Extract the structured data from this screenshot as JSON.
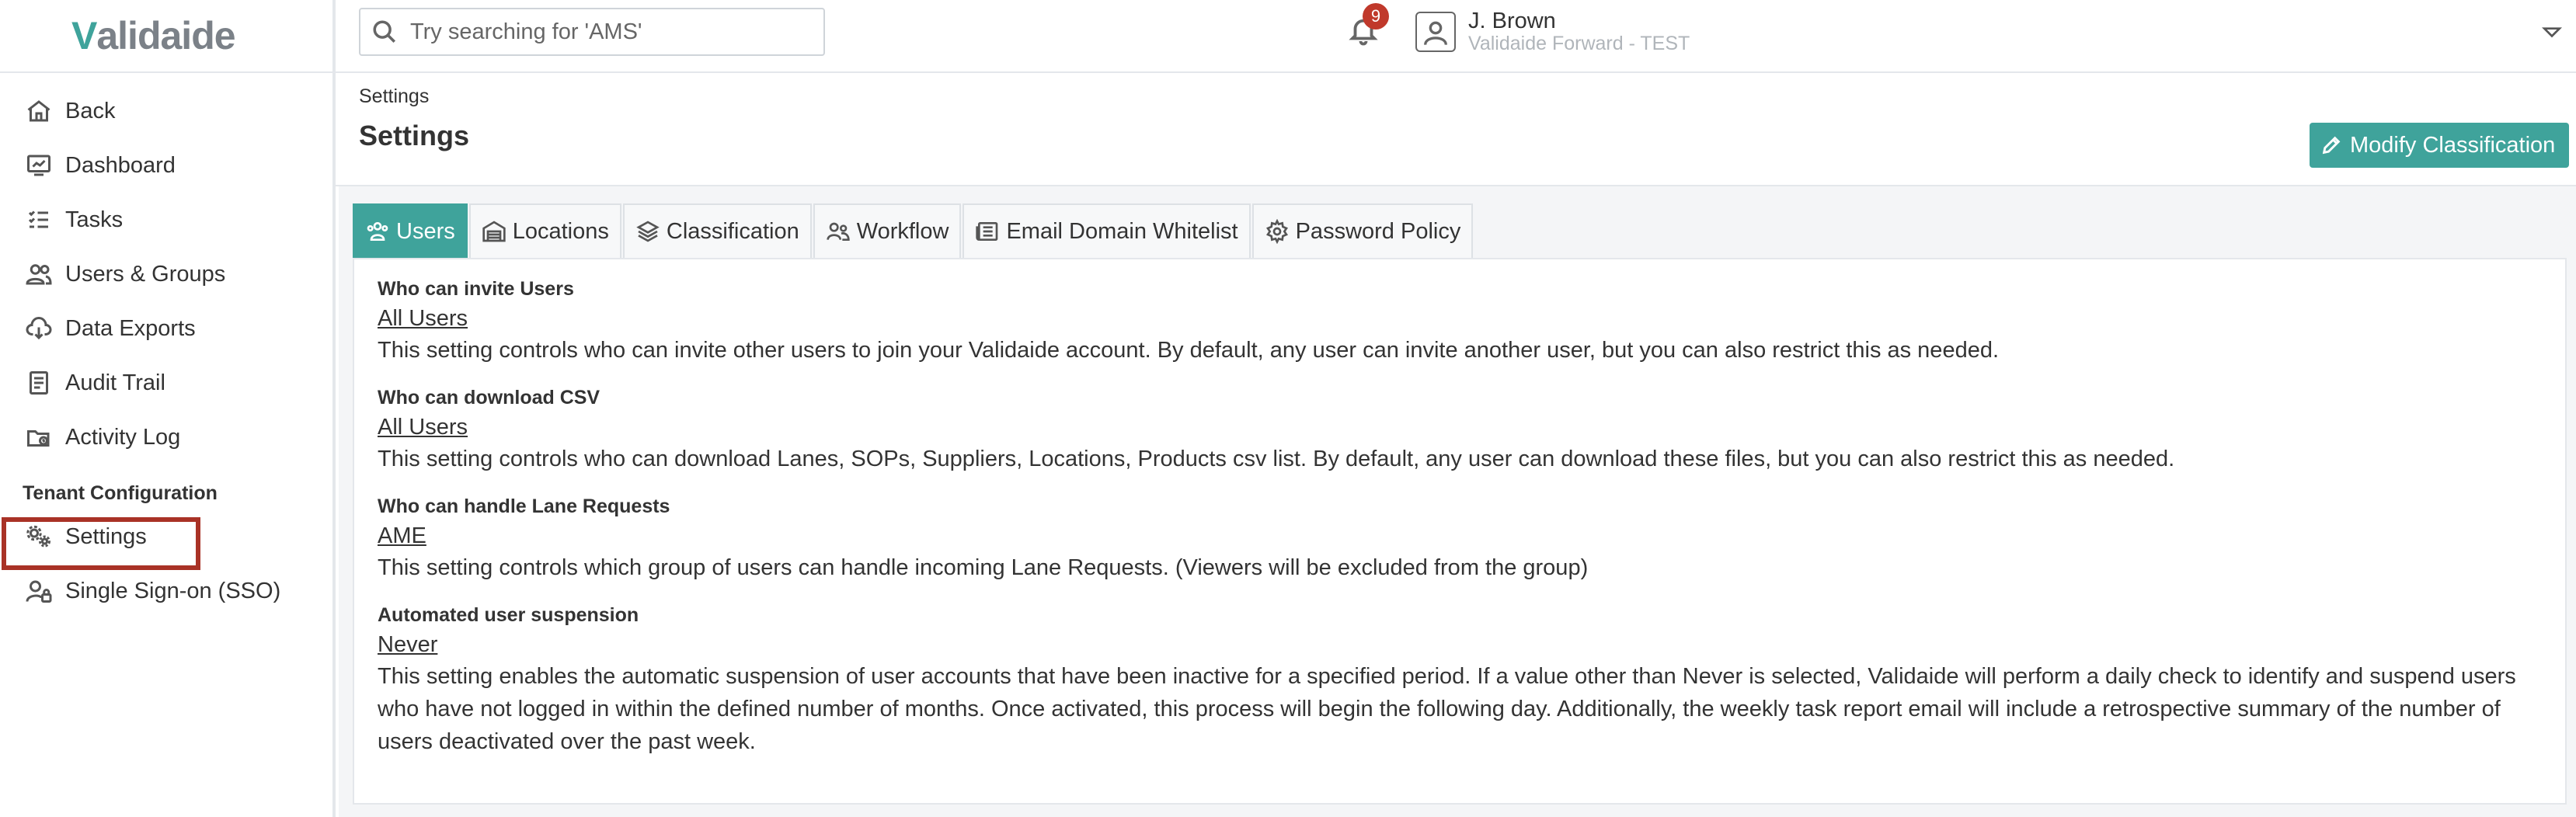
{
  "logo": "Validaide",
  "search": {
    "placeholder": "Try searching for 'AMS'"
  },
  "notifications": {
    "count": "9"
  },
  "user": {
    "name": "J. Brown",
    "org": "Validaide Forward - TEST"
  },
  "sidebar": {
    "items": [
      {
        "label": "Back",
        "icon": "home-icon"
      },
      {
        "label": "Dashboard",
        "icon": "dashboard-icon"
      },
      {
        "label": "Tasks",
        "icon": "tasks-icon"
      },
      {
        "label": "Users & Groups",
        "icon": "users-icon"
      },
      {
        "label": "Data Exports",
        "icon": "download-icon"
      },
      {
        "label": "Audit Trail",
        "icon": "audit-icon"
      },
      {
        "label": "Activity Log",
        "icon": "activity-icon"
      }
    ],
    "section_title": "Tenant Configuration",
    "config_items": [
      {
        "label": "Settings",
        "icon": "settings-icon"
      },
      {
        "label": "Single Sign-on (SSO)",
        "icon": "user-lock-icon"
      }
    ]
  },
  "header": {
    "breadcrumb": "Settings",
    "title": "Settings",
    "action_label": "Modify Classification"
  },
  "tabs": [
    {
      "label": "Users",
      "active": true
    },
    {
      "label": "Locations",
      "active": false
    },
    {
      "label": "Classification",
      "active": false
    },
    {
      "label": "Workflow",
      "active": false
    },
    {
      "label": "Email Domain Whitelist",
      "active": false
    },
    {
      "label": "Password Policy",
      "active": false
    }
  ],
  "settings": [
    {
      "title": "Who can invite Users",
      "value": "All Users",
      "description": "This setting controls who can invite other users to join your Validaide account. By default, any user can invite another user, but you can also restrict this as needed."
    },
    {
      "title": "Who can download CSV",
      "value": "All Users",
      "description": "This setting controls who can download Lanes, SOPs, Suppliers, Locations, Products csv list. By default, any user can download these files, but you can also restrict this as needed."
    },
    {
      "title": "Who can handle Lane Requests",
      "value": "AME",
      "description": "This setting controls which group of users can handle incoming Lane Requests. (Viewers will be excluded from the group)"
    },
    {
      "title": "Automated user suspension",
      "value": "Never",
      "description": "This setting enables the automatic suspension of user accounts that have been inactive for a specified period. If a value other than Never is selected, Validaide will perform a daily check to identify and suspend users who have not logged in within the defined number of months. Once activated, this process will begin the following day. Additionally, the weekly task report email will include a retrospective summary of the number of users deactivated over the past week."
    }
  ],
  "colors": {
    "accent": "#3fa39b",
    "highlight_box": "#a93226",
    "badge": "#c0392b"
  }
}
